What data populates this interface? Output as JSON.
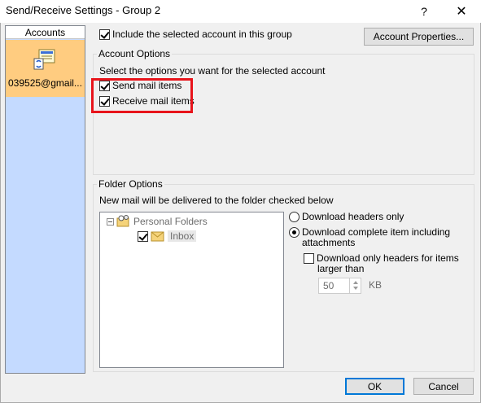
{
  "window": {
    "title": "Send/Receive Settings - Group 2",
    "help_glyph": "?",
    "close_glyph": "✕"
  },
  "accounts": {
    "header": "Accounts",
    "items": [
      {
        "label": "039525@gmail...."
      }
    ]
  },
  "include_account": {
    "label": "Include the selected account in this group",
    "checked": true
  },
  "account_properties_button": "Account Properties...",
  "account_options": {
    "title": "Account Options",
    "description": "Select the options you want for the selected account",
    "send_mail": {
      "label": "Send mail items",
      "checked": true
    },
    "receive_mail": {
      "label": "Receive mail items",
      "checked": true
    }
  },
  "folder_options": {
    "title": "Folder Options",
    "description": "New mail will be delivered to the folder checked below",
    "tree": {
      "root": "Personal Folders",
      "child": "Inbox",
      "child_checked": true
    },
    "radios": {
      "headers_only": "Download headers only",
      "complete_line1": "Download complete item including",
      "complete_line2": "attachments",
      "selected": "complete"
    },
    "only_headers": {
      "line1": "Download only headers for items",
      "line2": "larger than",
      "checked": false
    },
    "size_value": "50",
    "size_unit": "KB"
  },
  "buttons": {
    "ok": "OK",
    "cancel": "Cancel"
  },
  "colors": {
    "highlight": "#e8141b",
    "selected_account_bg": "#ffcc80",
    "accounts_bg": "#c4daff"
  }
}
